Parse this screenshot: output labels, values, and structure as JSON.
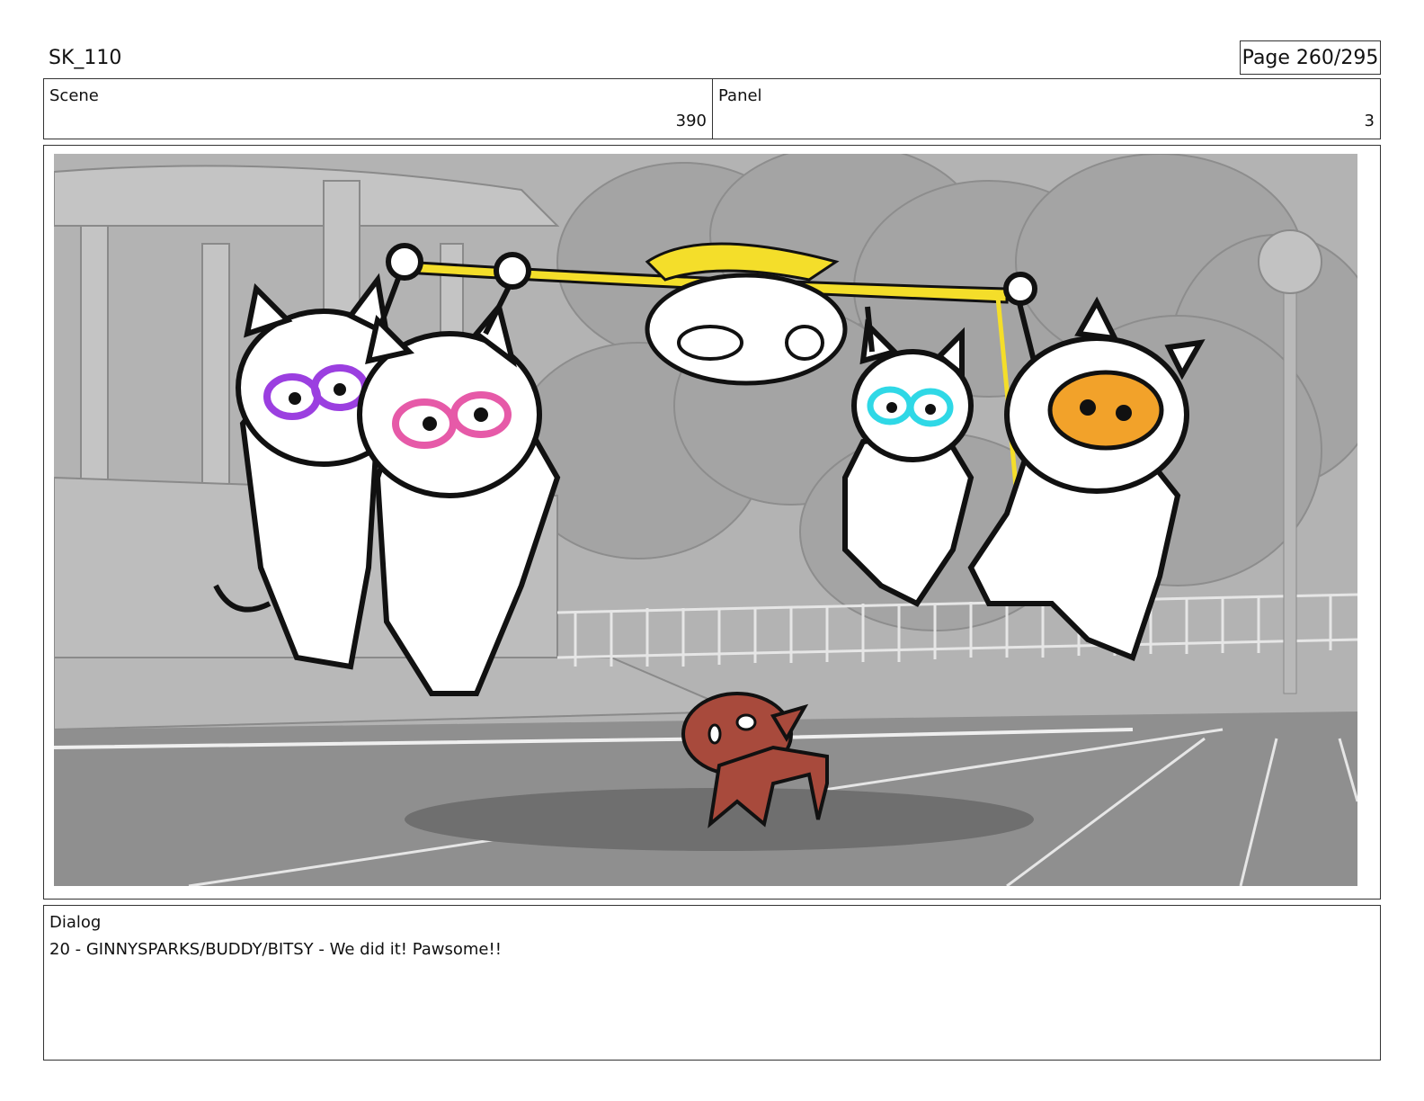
{
  "header": {
    "sheet_id": "SK_110",
    "page_label": "Page 260/295"
  },
  "scene": {
    "label": "Scene",
    "value": "390"
  },
  "panel": {
    "label": "Panel",
    "value": "3"
  },
  "dialog": {
    "label": "Dialog",
    "text": "20 - GINNYSPARKS/BUDDY/BITSY - We did it! Pawsome!!"
  },
  "artwork": {
    "icon": "storyboard-illustration",
    "colors": {
      "sky": "#b5b5b5",
      "ground": "#8f8f8f",
      "banner": "#f4de2a",
      "glasses_purple": "#9b3fe0",
      "glasses_pink": "#e65aa8",
      "glasses_cyan": "#2fd8e6",
      "mask_orange": "#f2a22a",
      "dog": "#a84a3c"
    }
  }
}
